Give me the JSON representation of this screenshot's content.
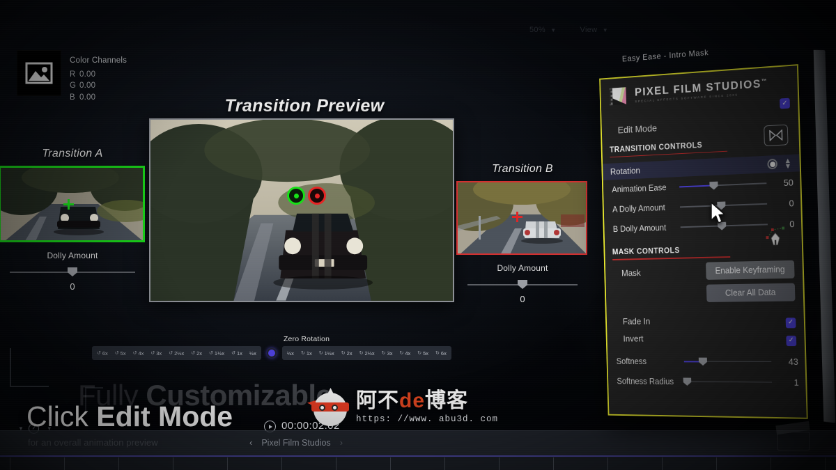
{
  "viewer": {
    "zoom_level": "50%",
    "view_label": "View"
  },
  "color_channels": {
    "title": "Color Channels",
    "thumb_icon": "image-icon",
    "rows": [
      {
        "channel": "R",
        "value": "0.00"
      },
      {
        "channel": "G",
        "value": "0.00"
      },
      {
        "channel": "B",
        "value": "0.00"
      }
    ]
  },
  "preview": {
    "title": "Transition Preview",
    "transition_a": {
      "label": "Transition A",
      "dolly_label": "Dolly Amount",
      "dolly_value": "0",
      "accent": "#19d219"
    },
    "transition_b": {
      "label": "Transition B",
      "dolly_label": "Dolly Amount",
      "dolly_value": "0",
      "accent": "#d43030"
    }
  },
  "rotation_strip": {
    "title": "Zero Rotation",
    "ccw": [
      "6x",
      "5x",
      "4x",
      "3x",
      "2½x",
      "2x",
      "1½x",
      "1x",
      "½x"
    ],
    "cw": [
      "½x",
      "1x",
      "1½x",
      "2x",
      "2½x",
      "3x",
      "4x",
      "5x",
      "6x"
    ],
    "selected": "zero"
  },
  "overlay": {
    "background_line_light": "Fully ",
    "background_line_bold": "Customizable",
    "headline_light": "Click ",
    "headline_bold": "Edit Mode",
    "subline": "for an overall animation preview"
  },
  "watermark": {
    "text_part1": "阿不",
    "text_de": "de",
    "text_part2": "博客",
    "url": "https: //www. abu3d. com"
  },
  "bottom_bar": {
    "timecode": "00:00:02:02",
    "breadcrumb": "Pixel Film Studios",
    "back_arrow": "‹",
    "forward_arrow": "›",
    "play_icon": "play-icon"
  },
  "inspector": {
    "panel_title": "Easy Ease - Intro Mask",
    "brand": {
      "name": "PIXEL FILM STUDIOS",
      "trademark": "™",
      "tagline": "SPECIAL EFFECTS SOFTWARE SINCE 2006"
    },
    "edit_mode": {
      "label": "Edit Mode",
      "checked": true,
      "check_glyph": "✓"
    },
    "transition_section": {
      "title": "TRANSITION CONTROLS",
      "icon": "transition-icon",
      "rotation_row": {
        "label": "Rotation",
        "radio_icon": "radio-filled-icon",
        "stepper_icon": "stepper-up-down-icon"
      },
      "sliders": [
        {
          "label": "Animation Ease",
          "value": "50",
          "fill_pct": 40,
          "knob_pct": 40
        },
        {
          "label": "A Dolly Amount",
          "value": "0",
          "fill_pct": 0,
          "knob_pct": 48
        },
        {
          "label": "B Dolly Amount",
          "value": "0",
          "fill_pct": 0,
          "knob_pct": 48
        }
      ]
    },
    "mask_section": {
      "title": "MASK CONTROLS",
      "icon": "pen-tool-icon",
      "mask_label": "Mask",
      "enable_keyframing_label": "Enable Keyframing",
      "clear_all_data_label": "Clear All Data",
      "toggles": [
        {
          "label": "Fade In",
          "checked": true,
          "check_glyph": "✓"
        },
        {
          "label": "Invert",
          "checked": true,
          "check_glyph": "✓"
        }
      ],
      "sliders": [
        {
          "label": "Softness",
          "value": "43",
          "fill_pct": 22,
          "knob_pct": 22
        },
        {
          "label": "Softness Radius",
          "value": "1",
          "fill_pct": 0,
          "knob_pct": 3
        }
      ]
    }
  },
  "colors": {
    "panel_border": "#eded2f",
    "accent_checkbox": "#5145e8",
    "section_rule": "#bb2b2b",
    "slider_fill": "#5145e8"
  }
}
